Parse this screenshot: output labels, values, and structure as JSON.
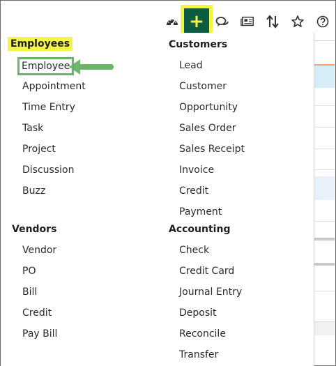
{
  "toolbar": {
    "icons": [
      {
        "name": "dashboard-icon"
      },
      {
        "name": "add-icon",
        "label": "+"
      },
      {
        "name": "chat-icon"
      },
      {
        "name": "news-icon"
      },
      {
        "name": "sort-icon"
      },
      {
        "name": "star-icon"
      },
      {
        "name": "help-icon"
      }
    ],
    "add_label": "+"
  },
  "menu": {
    "employees": {
      "heading": "Employees",
      "items": [
        "Employee",
        "Appointment",
        "Time Entry",
        "Task",
        "Project",
        "Discussion",
        "Buzz"
      ]
    },
    "customers": {
      "heading": "Customers",
      "items": [
        "Lead",
        "Customer",
        "Opportunity",
        "Sales Order",
        "Sales Receipt",
        "Invoice",
        "Credit",
        "Payment"
      ]
    },
    "vendors": {
      "heading": "Vendors",
      "items": [
        "Vendor",
        "PO",
        "Bill",
        "Credit",
        "Pay Bill"
      ]
    },
    "accounting": {
      "heading": "Accounting",
      "items": [
        "Check",
        "Credit Card",
        "Journal Entry",
        "Deposit",
        "Reconcile",
        "Transfer"
      ]
    }
  },
  "colors": {
    "highlight": "#f5f448",
    "add_button": "#0b5c41",
    "add_symbol": "#f7f14b",
    "callout_arrow": "#6db46b"
  }
}
